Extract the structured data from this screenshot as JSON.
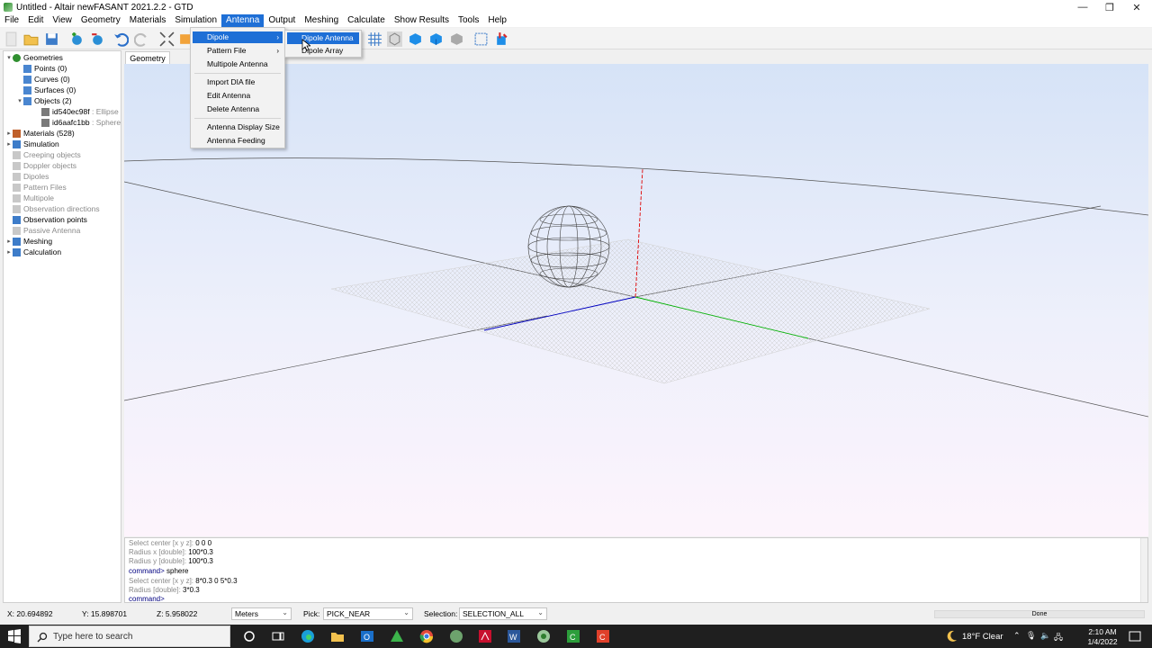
{
  "window": {
    "title": "Untitled - Altair newFASANT 2021.2.2 - GTD",
    "controls": [
      "—",
      "❐",
      "✕"
    ]
  },
  "menubar": [
    "File",
    "Edit",
    "View",
    "Geometry",
    "Materials",
    "Simulation",
    "Antenna",
    "Output",
    "Meshing",
    "Calculate",
    "Show Results",
    "Tools",
    "Help"
  ],
  "antenna_menu": {
    "items": [
      {
        "label": "Dipole",
        "submenu": true
      },
      {
        "label": "Pattern File",
        "submenu": true
      },
      {
        "label": "Multipole Antenna"
      },
      {
        "label": "Import DIA file"
      },
      {
        "label": "Edit Antenna"
      },
      {
        "label": "Delete Antenna"
      },
      {
        "label": "Antenna Display Size"
      },
      {
        "label": "Antenna Feeding"
      }
    ]
  },
  "dipole_submenu": {
    "items": [
      "Dipole Antenna",
      "Dipole Array"
    ]
  },
  "tree": {
    "geometries": "Geometries",
    "points": "Points (0)",
    "curves": "Curves (0)",
    "surfaces": "Surfaces (0)",
    "objects": "Objects (2)",
    "object1_id": "id540ec98f",
    "object1_type": ": Ellipse",
    "object2_id": "id6aafc1bb",
    "object2_type": ": Sphere",
    "materials": "Materials (528)",
    "simulation": "Simulation",
    "creeping": "Creeping objects",
    "doppler": "Doppler objects",
    "dipoles": "Dipoles",
    "pattern_files": "Pattern Files",
    "multipole": "Multipole",
    "obs_dirs": "Observation directions",
    "obs_points": "Observation points",
    "passive": "Passive Antenna",
    "meshing": "Meshing",
    "calculation": "Calculation"
  },
  "view_tab": "Geometry",
  "console": [
    {
      "prompt": "Select center [x y z]:",
      "value": " 0 0 0"
    },
    {
      "prompt": "Radius x [double]:",
      "value": " 100*0.3"
    },
    {
      "prompt": "Radius y [double]:",
      "value": " 100*0.3"
    },
    {
      "cmd": "command>",
      "value": " sphere"
    },
    {
      "prompt": "Select center [x y z]:",
      "value": " 8*0.3 0 5*0.3"
    },
    {
      "prompt": "Radius [double]:",
      "value": " 3*0.3"
    },
    {
      "cmd": "command>",
      "value": ""
    }
  ],
  "status": {
    "x": "X: 20.694892",
    "y": "Y: 15.898701",
    "z": "Z: 5.958022",
    "units": "Meters",
    "pick_label": "Pick:",
    "pick_value": "PICK_NEAR",
    "selection_label": "Selection:",
    "selection_value": "SELECTION_ALL",
    "progress_text": "Done"
  },
  "taskbar": {
    "search_placeholder": "Type here to search",
    "weather": "18°F  Clear",
    "time": "2:10 AM",
    "date": "1/4/2022"
  },
  "colors": {
    "accent": "#1e6fd6",
    "axis_x": "#0000c0",
    "axis_y": "#00b000",
    "axis_z": "#e00000",
    "taskbar": "#1f1f1f"
  }
}
